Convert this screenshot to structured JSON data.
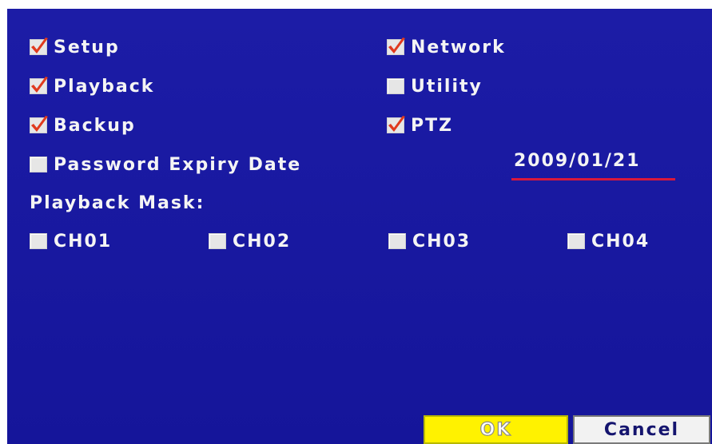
{
  "permissions": {
    "setup": {
      "label": "Setup",
      "checked": true
    },
    "network": {
      "label": "Network",
      "checked": true
    },
    "playback": {
      "label": "Playback",
      "checked": true
    },
    "utility": {
      "label": "Utility",
      "checked": false
    },
    "backup": {
      "label": "Backup",
      "checked": true
    },
    "ptz": {
      "label": "PTZ",
      "checked": true
    }
  },
  "password_expiry": {
    "label": "Password Expiry Date",
    "checked": false,
    "date": "2009/01/21"
  },
  "playback_mask": {
    "title": "Playback Mask:",
    "channels": [
      {
        "label": "CH01",
        "checked": false
      },
      {
        "label": "CH02",
        "checked": false
      },
      {
        "label": "CH03",
        "checked": false
      },
      {
        "label": "CH04",
        "checked": false
      }
    ]
  },
  "buttons": {
    "ok": "OK",
    "cancel": "Cancel"
  },
  "colors": {
    "panel_bg": "#1a1aa0",
    "check_mark": "#e03a1e",
    "date_underline": "#d8183c",
    "ok_bg": "#fff200"
  },
  "icons": {
    "checked": "checkbox-checked-icon",
    "unchecked": "checkbox-unchecked-icon"
  }
}
